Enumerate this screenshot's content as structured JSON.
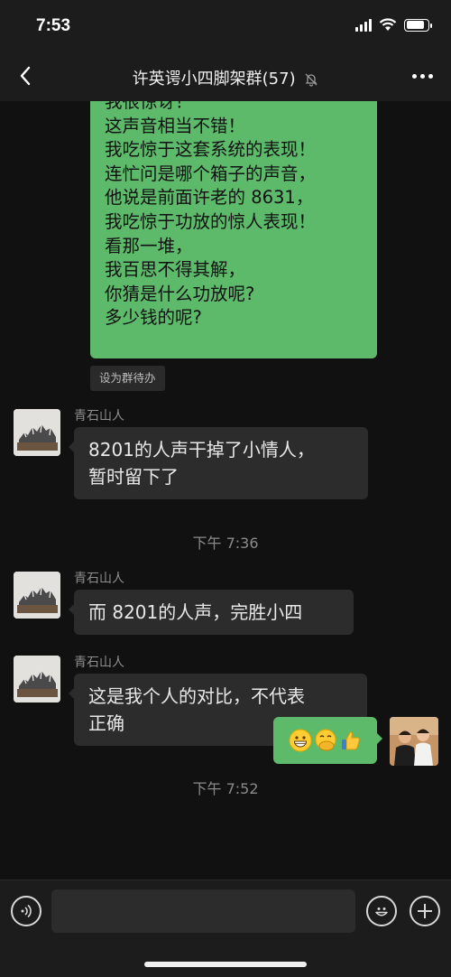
{
  "status": {
    "time": "7:53"
  },
  "nav": {
    "title": "许英谔小四脚架群(57)"
  },
  "messages": {
    "first_bubble_lines": [
      "我很惊讶！",
      "这声音相当不错！",
      "我吃惊于这套系统的表现！",
      "连忙问是哪个箱子的声音，",
      "他说是前面许老的 8631，",
      "我吃惊于功放的惊人表现！",
      "看那一堆，",
      "我百思不得其解，",
      "你猜是什么功放呢?",
      "多少钱的呢?"
    ],
    "todo_tag": "设为群待办",
    "sender_name": "青石山人",
    "msg1_lines": [
      "8201的人声干掉了小情人，",
      "暂时留下了"
    ],
    "time1": "下午 7:36",
    "msg2": "而 8201的人声，完胜小四",
    "msg3_lines": [
      "这是我个人的对比，不代表",
      "正确"
    ],
    "time2": "下午 7:52",
    "my_message_emojis": [
      "grinning-face",
      "face-with-hand-over-mouth",
      "thumbs-up"
    ]
  },
  "input": {
    "placeholder": ""
  },
  "icons": {
    "back": "chevron-left-icon",
    "mute": "bell-slash-icon",
    "more": "more-dots-icon",
    "voice": "voice-icon",
    "emoji": "emoji-icon",
    "plus": "plus-icon"
  },
  "colors": {
    "accent_green": "#5dba6a",
    "background": "#111111",
    "bubble_dark": "#2c2c2c"
  }
}
